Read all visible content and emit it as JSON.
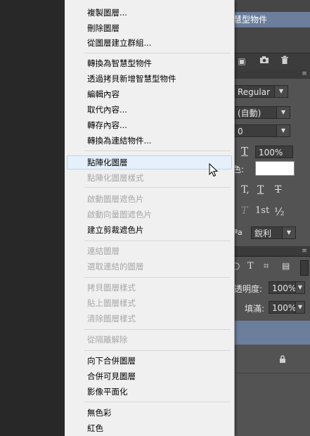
{
  "menu": {
    "items": [
      {
        "label": "複製圖層...",
        "disabled": false
      },
      {
        "label": "刪除圖層",
        "disabled": false
      },
      {
        "label": "從圖層建立群組...",
        "disabled": false
      },
      {
        "label": "轉換為智慧型物件",
        "disabled": false
      },
      {
        "label": "透過拷貝新增智慧型物件",
        "disabled": false
      },
      {
        "label": "編輯內容",
        "disabled": false
      },
      {
        "label": "取代內容...",
        "disabled": false
      },
      {
        "label": "轉存內容...",
        "disabled": false
      },
      {
        "label": "轉換為連結物件...",
        "disabled": false
      },
      {
        "label": "點陣化圖層",
        "disabled": false,
        "highlighted": true
      },
      {
        "label": "點陣化圖層樣式",
        "disabled": true
      },
      {
        "label": "啟動圖層遮色片",
        "disabled": true
      },
      {
        "label": "啟動向量圖遮色片",
        "disabled": true
      },
      {
        "label": "建立剪裁遮色片",
        "disabled": false
      },
      {
        "label": "連結圖層",
        "disabled": true
      },
      {
        "label": "選取連結的圖層",
        "disabled": true
      },
      {
        "label": "拷貝圖層樣式",
        "disabled": true
      },
      {
        "label": "貼上圖層樣式",
        "disabled": true
      },
      {
        "label": "清除圖層樣式",
        "disabled": true
      },
      {
        "label": "從隔離解除",
        "disabled": true
      },
      {
        "label": "向下合併圖層",
        "disabled": false
      },
      {
        "label": "合併可見圖層",
        "disabled": false
      },
      {
        "label": "影像平面化",
        "disabled": false
      },
      {
        "label": "無色彩",
        "disabled": false
      },
      {
        "label": "紅色",
        "disabled": false
      }
    ]
  },
  "layers_panel": {
    "selected_layer_name": "慧型物件",
    "opacity_label": "透明度:",
    "opacity_value": "100%",
    "fill_label": "填滿:",
    "fill_value": "100%"
  },
  "character_panel": {
    "font_style": "Regular",
    "leading": "(自動)",
    "tracking": "0",
    "horizontal_scale": "100%",
    "color_label": "色:",
    "antialias_label": "ªa",
    "antialias_value": "銳利",
    "glyph_t_small": "T,",
    "glyph_t_under": "T",
    "glyph_t_strike": "T",
    "glyph_t_italic": "T",
    "glyph_ordinal": "1st",
    "glyph_fraction": "½"
  },
  "icons": {
    "cursor": "mouse-pointer-icon",
    "camera": "camera-icon",
    "trash": "trash-icon",
    "lock": "lock-icon"
  }
}
